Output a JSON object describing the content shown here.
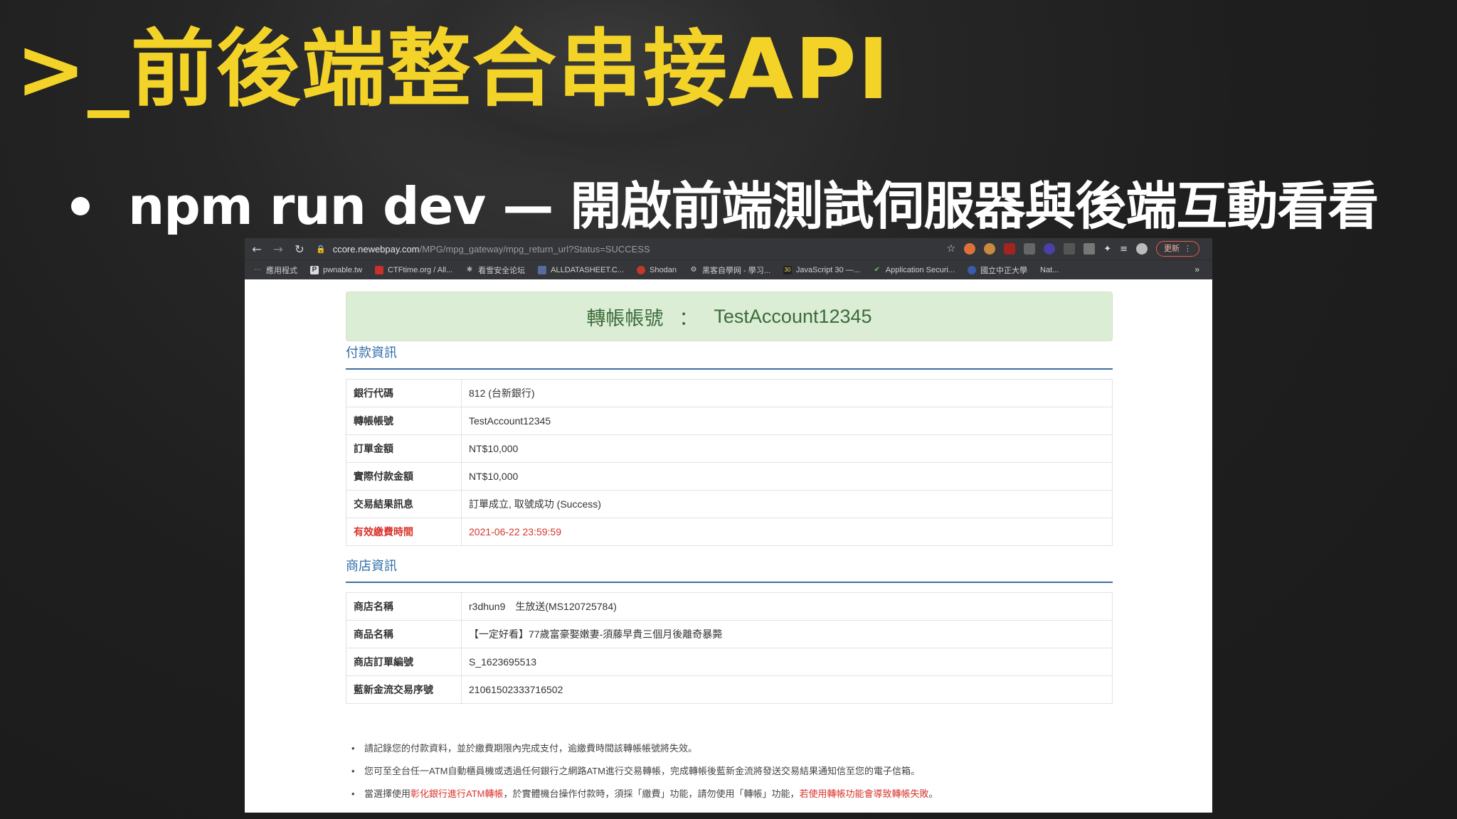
{
  "slide": {
    "title": ">_前後端整合串接API",
    "bullet": "npm run dev — 開啟前端測試伺服器與後端互動看看"
  },
  "browser": {
    "url_host": "ccore.newebpay.com",
    "url_path": "/MPG/mpg_gateway/mpg_return_url?Status=SUCCESS",
    "update_label": "更新",
    "bookmarks": [
      {
        "label": "應用程式",
        "icon": "apps-grid-icon"
      },
      {
        "label": "pwnable.tw",
        "icon": "p-icon"
      },
      {
        "label": "CTFtime.org / All...",
        "icon": "ctftime-flag-icon"
      },
      {
        "label": "看雪安全论坛",
        "icon": "kanxue-icon"
      },
      {
        "label": "ALLDATASHEET.C...",
        "icon": "alldatasheet-icon"
      },
      {
        "label": "Shodan",
        "icon": "shodan-icon"
      },
      {
        "label": "黑客自學网 - 學习...",
        "icon": "hacker-icon"
      },
      {
        "label": "JavaScript 30 —...",
        "icon": "js30-icon"
      },
      {
        "label": "Application Securi...",
        "icon": "check-icon"
      },
      {
        "label": "國立中正大學",
        "icon": "university-icon"
      },
      {
        "label": "Nat...",
        "icon": "generic-icon"
      }
    ],
    "bookmarks_more": "»"
  },
  "page": {
    "account_label": "轉帳帳號",
    "account_sep": "：",
    "account_value": "TestAccount12345",
    "payment_section": "付款資訊",
    "payment_rows": [
      {
        "k": "銀行代碼",
        "v": "812 (台新銀行)"
      },
      {
        "k": "轉帳帳號",
        "v": "TestAccount12345"
      },
      {
        "k": "訂單金額",
        "v": "NT$10,000"
      },
      {
        "k": "實際付款金額",
        "v": "NT$10,000"
      },
      {
        "k": "交易結果訊息",
        "v": "訂單成立, 取號成功 (Success)"
      },
      {
        "k": "有效繳費時間",
        "v": "2021-06-22 23:59:59"
      }
    ],
    "store_section": "商店資訊",
    "store_rows": [
      {
        "k": "商店名稱",
        "v": "r3dhun9　生放送(MS120725784)"
      },
      {
        "k": "商品名稱",
        "v": "【一定好看】77歲富豪娶嫩妻-須藤早貴三個月後離奇暴斃"
      },
      {
        "k": "商店訂單編號",
        "v": "S_1623695513"
      },
      {
        "k": "藍新金流交易序號",
        "v": "21061502333716502"
      }
    ],
    "notes": [
      "請記錄您的付款資料，並於繳費期限內完成支付，逾繳費時間該轉帳帳號將失效。",
      "您可至全台任一ATM自動櫃員機或透過任何銀行之網路ATM進行交易轉帳，完成轉帳後藍新金流將發送交易結果通知信至您的電子信箱。"
    ],
    "note3_a": "當選擇使用",
    "note3_red1": "彰化銀行進行ATM轉帳",
    "note3_b": "，於實體機台操作付款時，須採「繳費」功能，請勿使用「轉帳」功能，",
    "note3_red2": "若使用轉帳功能會導致轉帳失敗",
    "note3_c": "。"
  },
  "colors": {
    "title_yellow": "#f4d329",
    "alert_bg": "#dcedd6",
    "section_blue": "#2f6ea7",
    "warn_red": "#d9332b"
  }
}
